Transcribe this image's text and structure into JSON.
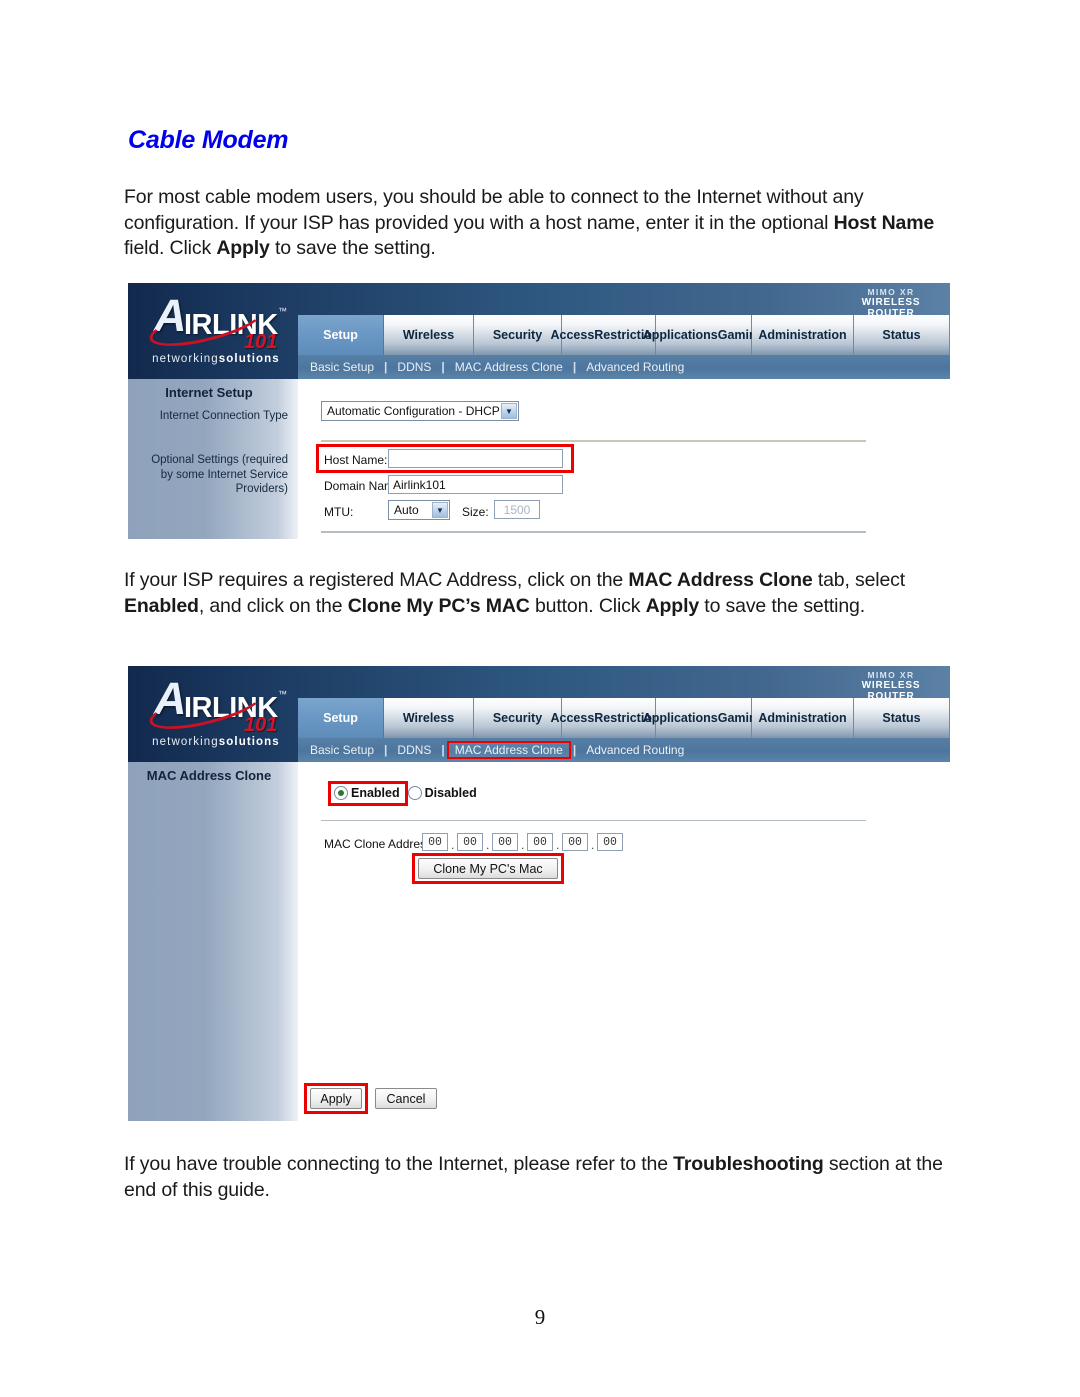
{
  "document": {
    "heading": "Cable Modem",
    "page_number": "9",
    "paragraphs": {
      "intro": "For most cable modem users, you should be able to connect to the Internet without any configuration. If your ISP has provided you with a host name, enter it in the optional <b>Host Name</b> field. Click <b>Apply</b> to save the setting.",
      "mac": "If your ISP requires a registered MAC Address, click on the <b>MAC Address Clone</b> tab, select <b>Enabled</b>, and click on the <b>Clone My PC’s MAC</b> button. Click <b>Apply</b> to save the setting.",
      "trouble": "If you have trouble connecting to the Internet, please refer to the <b>Troubleshooting</b> section at the end of this guide."
    }
  },
  "colors": {
    "heading": "#0000ee",
    "highlight_box": "#ee0000",
    "tab_active": "#5e8cba",
    "logo_red": "#d41326"
  },
  "router_ui": {
    "brand": {
      "logo_a": "A",
      "logo_word": "IRLINK",
      "logo_tm": "™",
      "logo_101": "101",
      "logo_sub_plain": "networking",
      "logo_sub_bold": "solutions",
      "mimo_line1": "MIMO XR",
      "mimo_line2": "WIRELESS ROUTER"
    },
    "tabs": [
      {
        "label": "Setup",
        "active": true
      },
      {
        "label": "Wireless",
        "active": false
      },
      {
        "label": "Security",
        "active": false
      },
      {
        "label": "Access\nRestrictions",
        "active": false
      },
      {
        "label": "Applications\nGaming",
        "active": false
      },
      {
        "label": "Administration",
        "active": false
      },
      {
        "label": "Status",
        "active": false
      }
    ],
    "subtabs": [
      "Basic Setup",
      "DDNS",
      "MAC Address Clone",
      "Advanced Routing"
    ]
  },
  "screen_basic_setup": {
    "side_title": "Internet Setup",
    "side_label_connection": "Internet Connection Type",
    "side_label_optional": "Optional Settings (required by some Internet Service Providers)",
    "connection_type_value": "Automatic Configuration - DHCP",
    "host_name_label": "Host Name:",
    "host_name_value": "",
    "domain_name_label": "Domain Name:",
    "domain_name_value": "Airlink101",
    "mtu_label": "MTU:",
    "mtu_value": "Auto",
    "size_label": "Size:",
    "size_value": "1500",
    "highlighted_subtab": null
  },
  "screen_mac_clone": {
    "side_title": "MAC Address Clone",
    "enabled_label": "Enabled",
    "disabled_label": "Disabled",
    "enabled_selected": true,
    "mac_label": "MAC Clone Address:",
    "mac_octets": [
      "00",
      "00",
      "00",
      "00",
      "00",
      "00"
    ],
    "clone_button": "Clone My PC's Mac",
    "apply_button": "Apply",
    "cancel_button": "Cancel",
    "highlighted_subtab": "MAC Address Clone"
  }
}
